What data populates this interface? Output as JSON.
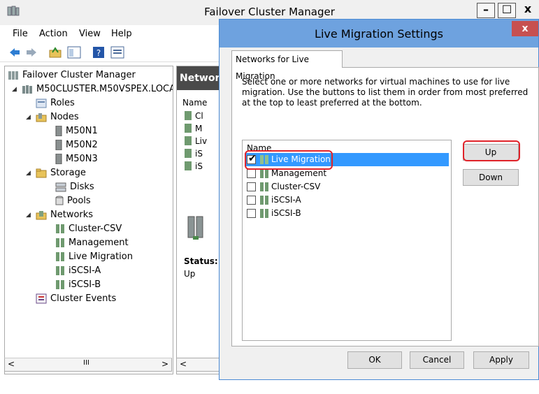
{
  "main_window": {
    "title": "Failover Cluster Manager",
    "controls": {
      "minimize": "–",
      "maximize": "☐",
      "close": "x"
    }
  },
  "menu": [
    "File",
    "Action",
    "View",
    "Help"
  ],
  "tree": {
    "root": "Failover Cluster Manager",
    "cluster": "M50CLUSTER.M50VSPEX.LOCAL",
    "roles": "Roles",
    "nodes": "Nodes",
    "node_items": [
      "M50N1",
      "M50N2",
      "M50N3"
    ],
    "storage": "Storage",
    "storage_items": [
      "Disks",
      "Pools"
    ],
    "networks": "Networks",
    "network_items": [
      "Cluster-CSV",
      "Management",
      "Live Migration",
      "iSCSI-A",
      "iSCSI-B"
    ],
    "events": "Cluster Events",
    "scroll_label": "III"
  },
  "middle": {
    "header": "Networ",
    "column": "Name",
    "items": [
      "Cl",
      "M",
      "Liv",
      "iS",
      "iS"
    ],
    "status_label": "Status:",
    "status_value": "Up"
  },
  "dialog": {
    "title": "Live Migration Settings",
    "close": "x",
    "tab": "Networks for Live Migration",
    "instructions": "Select one or more networks for virtual machines to use for live migration. Use the buttons to list them in order from most preferred at the top to least preferred at the bottom.",
    "list_header": "Name",
    "networks": [
      {
        "label": "Live Migration",
        "checked": true,
        "selected": true
      },
      {
        "label": "Management",
        "checked": false,
        "selected": false
      },
      {
        "label": "Cluster-CSV",
        "checked": false,
        "selected": false
      },
      {
        "label": "iSCSI-A",
        "checked": false,
        "selected": false
      },
      {
        "label": "iSCSI-B",
        "checked": false,
        "selected": false
      }
    ],
    "up_button": "Up",
    "down_button": "Down",
    "ok_button": "OK",
    "cancel_button": "Cancel",
    "apply_button": "Apply"
  },
  "colors": {
    "dialog_titlebar": "#6ea2df",
    "selection": "#3399ff",
    "highlight_annotation": "#e0232a",
    "close_button": "#c75050"
  }
}
